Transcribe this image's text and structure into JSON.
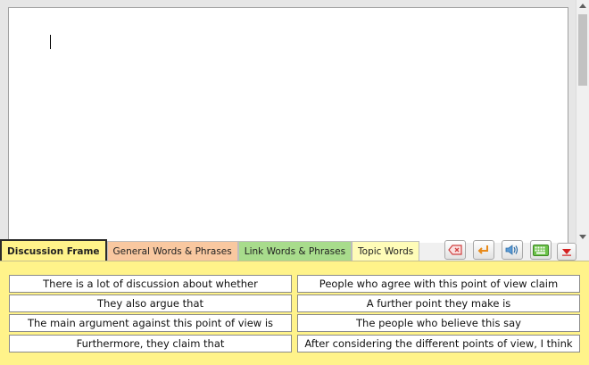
{
  "tabs": [
    {
      "label": "Discussion Frame",
      "active": true
    },
    {
      "label": "General Words & Phrases",
      "active": false
    },
    {
      "label": "Link Words & Phrases",
      "active": false
    },
    {
      "label": "Topic Words",
      "active": false
    }
  ],
  "toolbar": {
    "icons": [
      "backspace-icon",
      "enter-icon",
      "speaker-icon",
      "keyboard-icon",
      "collapse-icon"
    ]
  },
  "phrases": {
    "left": [
      "There is a lot of discussion about whether",
      "They also argue that",
      "The main argument against this point of view is",
      "Furthermore, they claim that"
    ],
    "right": [
      "People who agree with this point of view claim",
      "A further point they make is",
      "The people who believe this say",
      "After considering the different points of view, I think"
    ]
  },
  "colors": {
    "discussion_frame": "#fff38a",
    "general_words": "#f9c8a0",
    "link_words": "#a8dc8c",
    "topic_words": "#fffcb8"
  }
}
